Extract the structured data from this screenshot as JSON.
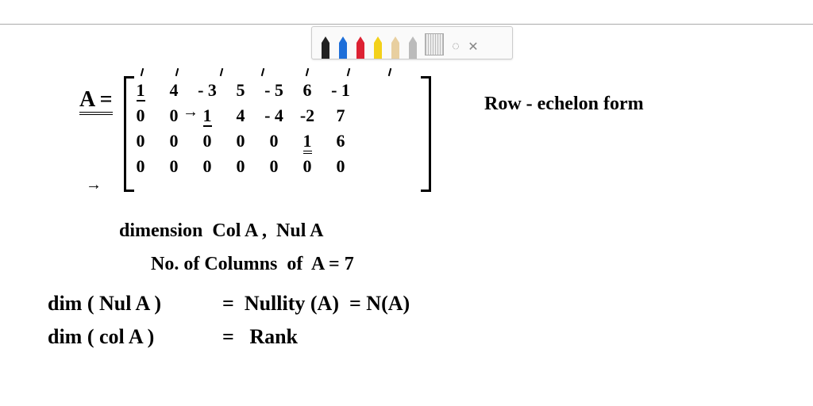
{
  "toolbar": {
    "pens": [
      {
        "name": "pen-black",
        "fill": "#222"
      },
      {
        "name": "pen-blue",
        "fill": "#1e6fd9"
      },
      {
        "name": "pen-red",
        "fill": "#d23"
      },
      {
        "name": "pen-yellow",
        "fill": "#f3d11a"
      },
      {
        "name": "pen-beige",
        "fill": "#e8cfa0"
      },
      {
        "name": "pen-gray",
        "fill": "#bbb"
      }
    ],
    "lasso_glyph": "◌",
    "close_glyph": "✕"
  },
  "equation": {
    "lhs": "A =",
    "rhs_label": "Row - echelon form"
  },
  "matrix": {
    "rows": [
      [
        "1",
        "4",
        "- 3",
        "5",
        "- 5",
        "6",
        "- 1"
      ],
      [
        "0",
        "0",
        "1",
        "4",
        "- 4",
        "-2",
        "7"
      ],
      [
        "0",
        "0",
        "0",
        "0",
        "0",
        "1",
        "6"
      ],
      [
        "0",
        "0",
        "0",
        "0",
        "0",
        "0",
        "0"
      ]
    ],
    "col_ticks": 7
  },
  "notes": {
    "l1": "dimension  Col A ,  Nul A",
    "l2": "No. of Columns  of  A = 7",
    "l3a": "dim ( Nul A )",
    "l3b": "=  Nullity (A)  = N(A)",
    "l4a": "dim ( col A )",
    "l4b": "=   Rank"
  }
}
